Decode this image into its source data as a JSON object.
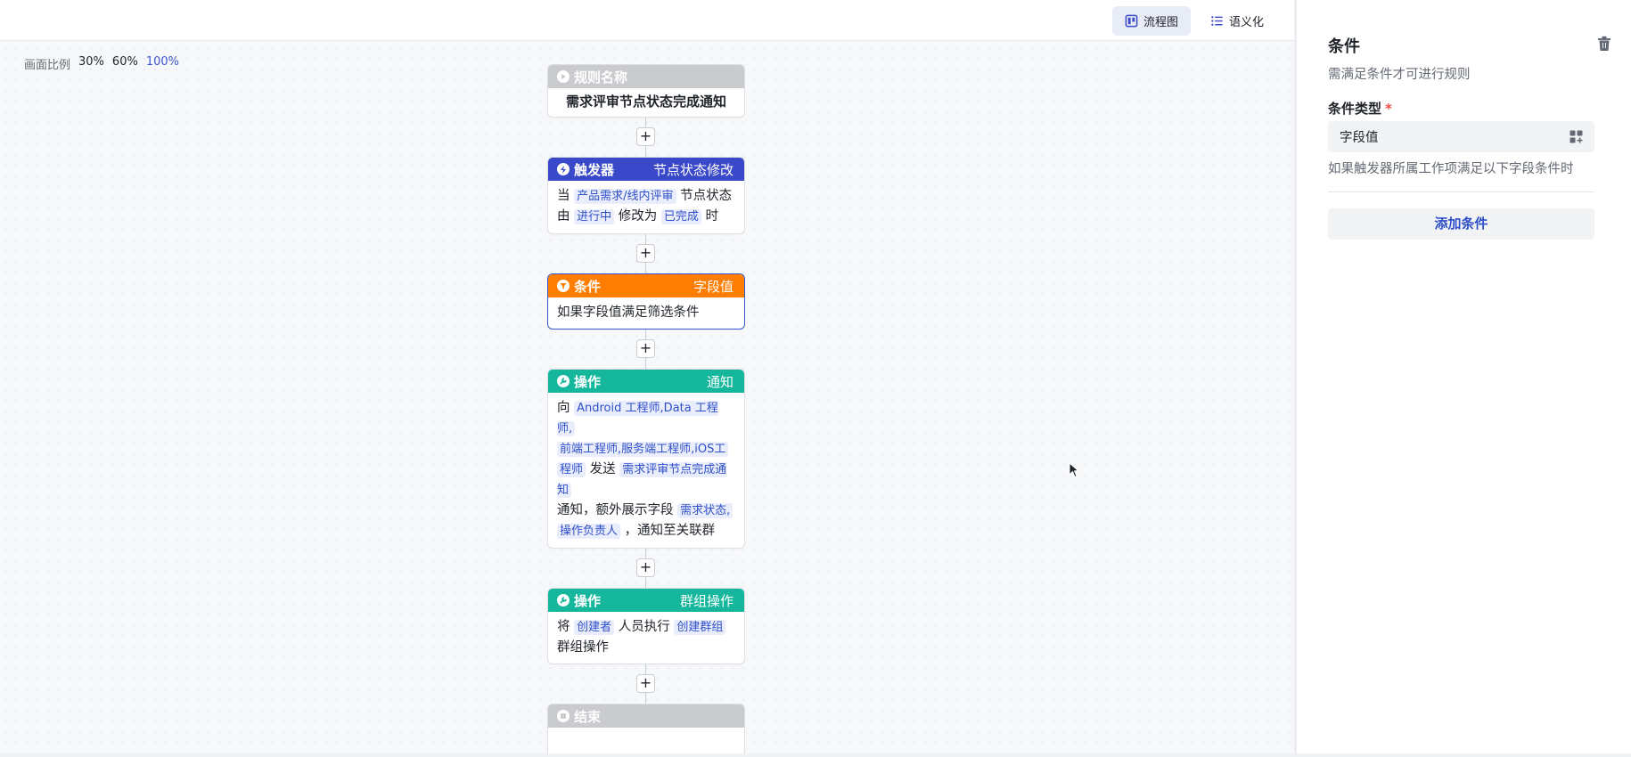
{
  "header": {
    "tabs": [
      {
        "label": "流程图",
        "active": true,
        "icon": "flowchart-icon"
      },
      {
        "label": "语义化",
        "active": false,
        "icon": "list-icon"
      }
    ]
  },
  "zoom": {
    "label": "画面比例",
    "options": [
      "30%",
      "60%",
      "100%"
    ],
    "active": "100%"
  },
  "flow": {
    "rule": {
      "header": "规则名称",
      "name": "需求评审节点状态完成通知"
    },
    "trigger": {
      "header": "触发器",
      "type": "节点状态修改",
      "t1": "当",
      "tag1": "产品需求/线内评审",
      "t2": "节点状态",
      "t3": "由",
      "tag2": "进行中",
      "t4": "修改为",
      "tag3": "已完成",
      "t5": "时"
    },
    "condition": {
      "header": "条件",
      "type": "字段值",
      "text": "如果字段值满足筛选条件"
    },
    "action1": {
      "header": "操作",
      "type": "通知",
      "t1": "向",
      "tag1": "Android 工程师,Data 工程师,",
      "tag2": "前端工程师,服务端工程师,iOS工",
      "tag3": "程师",
      "t2": "发送",
      "tag4": "需求评审节点完成通知",
      "t3": "通知，额外展示字段",
      "tag5": "需求状态,",
      "tag6": "操作负责人",
      "t4": "，通知至关联群"
    },
    "action2": {
      "header": "操作",
      "type": "群组操作",
      "t1": "将",
      "tag1": "创建者",
      "t2": "人员执行",
      "tag2": "创建群组",
      "t3": "群组操作"
    },
    "end": {
      "header": "结束"
    },
    "plus": "+"
  },
  "panel": {
    "title": "条件",
    "subtitle": "需满足条件才可进行规则",
    "field_label": "条件类型",
    "required_mark": "*",
    "select_value": "字段值",
    "hint": "如果触发器所属工作项满足以下字段条件时",
    "add_button": "添加条件"
  },
  "colors": {
    "trigger": "#3a49c9",
    "condition": "#ff7d00",
    "action": "#14b69c",
    "neutral": "#c9cbcf",
    "accent": "#3a58d0"
  }
}
